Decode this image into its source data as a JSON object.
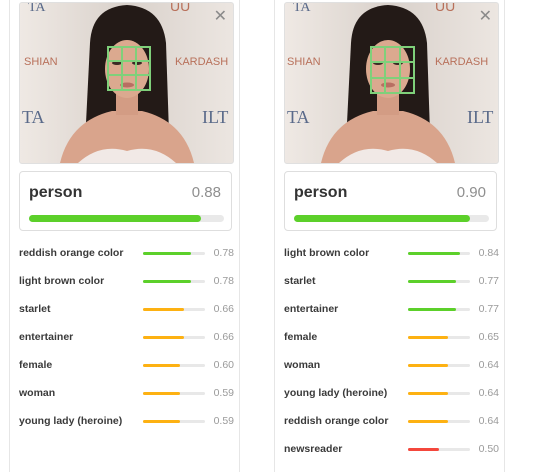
{
  "colors": {
    "high": "#5cd02a",
    "medium": "#fdb112",
    "low": "#f4473c"
  },
  "panels": [
    {
      "close_icon": "✕",
      "top": {
        "label": "person",
        "score": "0.88",
        "fraction": 0.88
      },
      "labels": [
        {
          "label": "reddish orange color",
          "score": "0.78",
          "fraction": 0.78,
          "level": "high"
        },
        {
          "label": "light brown color",
          "score": "0.78",
          "fraction": 0.78,
          "level": "high"
        },
        {
          "label": "starlet",
          "score": "0.66",
          "fraction": 0.66,
          "level": "medium"
        },
        {
          "label": "entertainer",
          "score": "0.66",
          "fraction": 0.66,
          "level": "medium"
        },
        {
          "label": "female",
          "score": "0.60",
          "fraction": 0.6,
          "level": "medium"
        },
        {
          "label": "woman",
          "score": "0.59",
          "fraction": 0.59,
          "level": "medium"
        },
        {
          "label": "young lady (heroine)",
          "score": "0.59",
          "fraction": 0.59,
          "level": "medium"
        }
      ]
    },
    {
      "close_icon": "✕",
      "top": {
        "label": "person",
        "score": "0.90",
        "fraction": 0.9
      },
      "labels": [
        {
          "label": "light brown color",
          "score": "0.84",
          "fraction": 0.84,
          "level": "high"
        },
        {
          "label": "starlet",
          "score": "0.77",
          "fraction": 0.77,
          "level": "high"
        },
        {
          "label": "entertainer",
          "score": "0.77",
          "fraction": 0.77,
          "level": "high"
        },
        {
          "label": "female",
          "score": "0.65",
          "fraction": 0.65,
          "level": "medium"
        },
        {
          "label": "woman",
          "score": "0.64",
          "fraction": 0.64,
          "level": "medium"
        },
        {
          "label": "young lady (heroine)",
          "score": "0.64",
          "fraction": 0.64,
          "level": "medium"
        },
        {
          "label": "reddish orange color",
          "score": "0.64",
          "fraction": 0.64,
          "level": "medium"
        },
        {
          "label": "newsreader",
          "score": "0.50",
          "fraction": 0.5,
          "level": "low"
        }
      ]
    }
  ]
}
